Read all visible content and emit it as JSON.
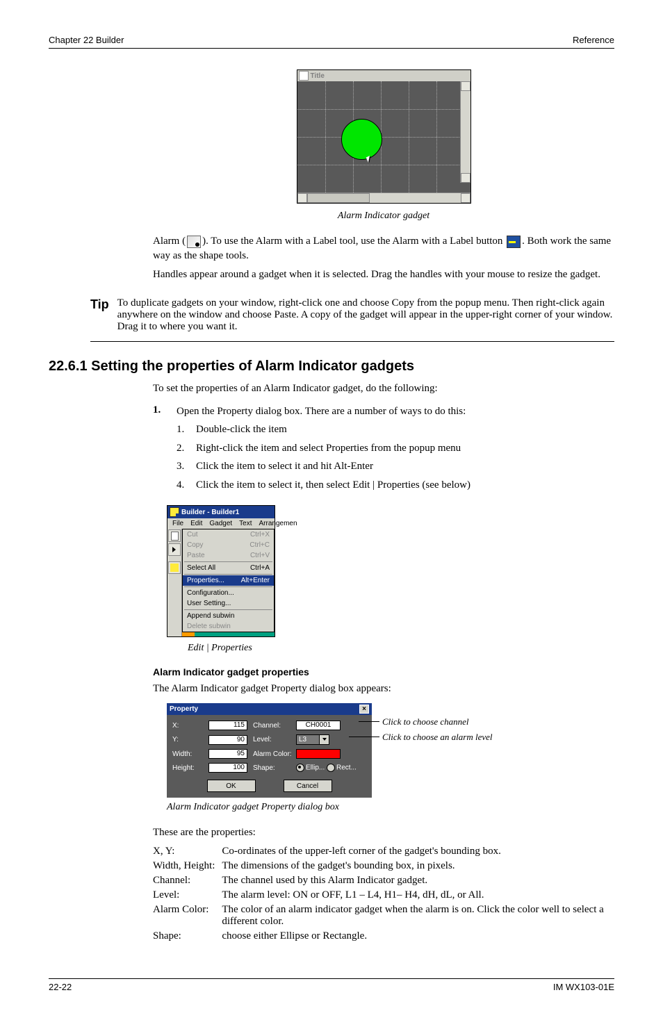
{
  "header": {
    "left": "Chapter 22 Builder",
    "right": "Reference"
  },
  "screenshot1": {
    "window_title": "Title",
    "caption": "Alarm Indicator gadget"
  },
  "tip": {
    "label": "Tip",
    "text": "To duplicate gadgets on your window, right-click one and choose Copy from the popup menu. Then right-click again anywhere on the window and choose Paste. A copy of the gadget will appear in the upper-right corner of your window. Drag it to where you want it."
  },
  "inline_text": {
    "para1_before_icon": " Alarm (",
    "para1_after_icon": "). To use the Alarm with a Label tool, use the Alarm with a Label button ",
    "para1_end": ". Both work the same way as the shape tools.",
    "para2": "Handles appear around a gadget when it is selected. Drag the handles with your mouse to resize the gadget."
  },
  "section_heading": "22.6.1 Setting the properties of Alarm Indicator gadgets",
  "intro_text": "To set the properties of an Alarm Indicator gadget, do the following:",
  "step_num": "1.",
  "substeps": [
    {
      "n": "1.",
      "text": "Double-click the item"
    },
    {
      "n": "2.",
      "text": "Right-click the item and select Properties from the popup menu"
    },
    {
      "n": "3.",
      "text": "Click the item to select it and hit Alt-Enter"
    },
    {
      "n": "4.",
      "text": "Click the item to select it, then select Edit | Properties (see below)"
    }
  ],
  "step_intro": "Open the Property dialog box. There are a number of ways to do this:",
  "builder_menu": {
    "title": "Builder - Builder1",
    "menus": [
      "File",
      "Edit",
      "Gadget",
      "Text",
      "Arrangemen"
    ],
    "items": [
      {
        "label": "Cut",
        "accel": "Ctrl+X",
        "disabled": true
      },
      {
        "label": "Copy",
        "accel": "Ctrl+C",
        "disabled": true
      },
      {
        "label": "Paste",
        "accel": "Ctrl+V",
        "disabled": true
      },
      {
        "sep": true
      },
      {
        "label": "Select All",
        "accel": "Ctrl+A"
      },
      {
        "sep": true
      },
      {
        "label": "Properties...",
        "accel": "Alt+Enter",
        "selected": true
      },
      {
        "sep": true
      },
      {
        "label": "Configuration..."
      },
      {
        "label": "User Setting..."
      },
      {
        "sep": true
      },
      {
        "label": "Append subwin"
      },
      {
        "label": "Delete subwin",
        "disabled": true
      }
    ],
    "caption": "Edit | Properties"
  },
  "alarm_props_intro": "The Alarm Indicator gadget Property dialog box appears:",
  "property_dialog": {
    "title": "Property",
    "x_label": "X:",
    "x_value": "115",
    "y_label": "Y:",
    "y_value": "90",
    "width_label": "Width:",
    "width_value": "95",
    "height_label": "Height:",
    "height_value": "100",
    "channel_label": "Channel:",
    "channel_value": "CH0001",
    "level_label": "Level:",
    "level_value": "L3",
    "alarmcolor_label": "Alarm Color:",
    "shape_label": "Shape:",
    "shape_opt1": "Ellip...",
    "shape_opt2": "Rect...",
    "ok": "OK",
    "cancel": "Cancel",
    "caption": "Alarm Indicator gadget Property dialog box",
    "callout1": "Click to choose channel",
    "callout2": "Click to choose an alarm level"
  },
  "after_dlg": "These are the properties:",
  "props_table": {
    "rows": [
      [
        "X, Y:",
        "Co-ordinates of the upper-left corner of the gadget's bounding box."
      ],
      [
        "Width, Height:",
        "The dimensions of the gadget's bounding box, in pixels."
      ],
      [
        "Channel:",
        "The channel used by this Alarm Indicator gadget."
      ],
      [
        "Level:",
        "The alarm level: ON or OFF, L1 – L4, H1– H4, dH, dL, or All."
      ],
      [
        "Alarm Color:",
        "The color of an alarm indicator gadget when the alarm is on. Click the color well to select a different color."
      ],
      [
        "Shape:",
        "choose either Ellipse or Rectangle."
      ]
    ]
  },
  "footer": {
    "left": "22-22",
    "right": "IM WX103-01E"
  }
}
